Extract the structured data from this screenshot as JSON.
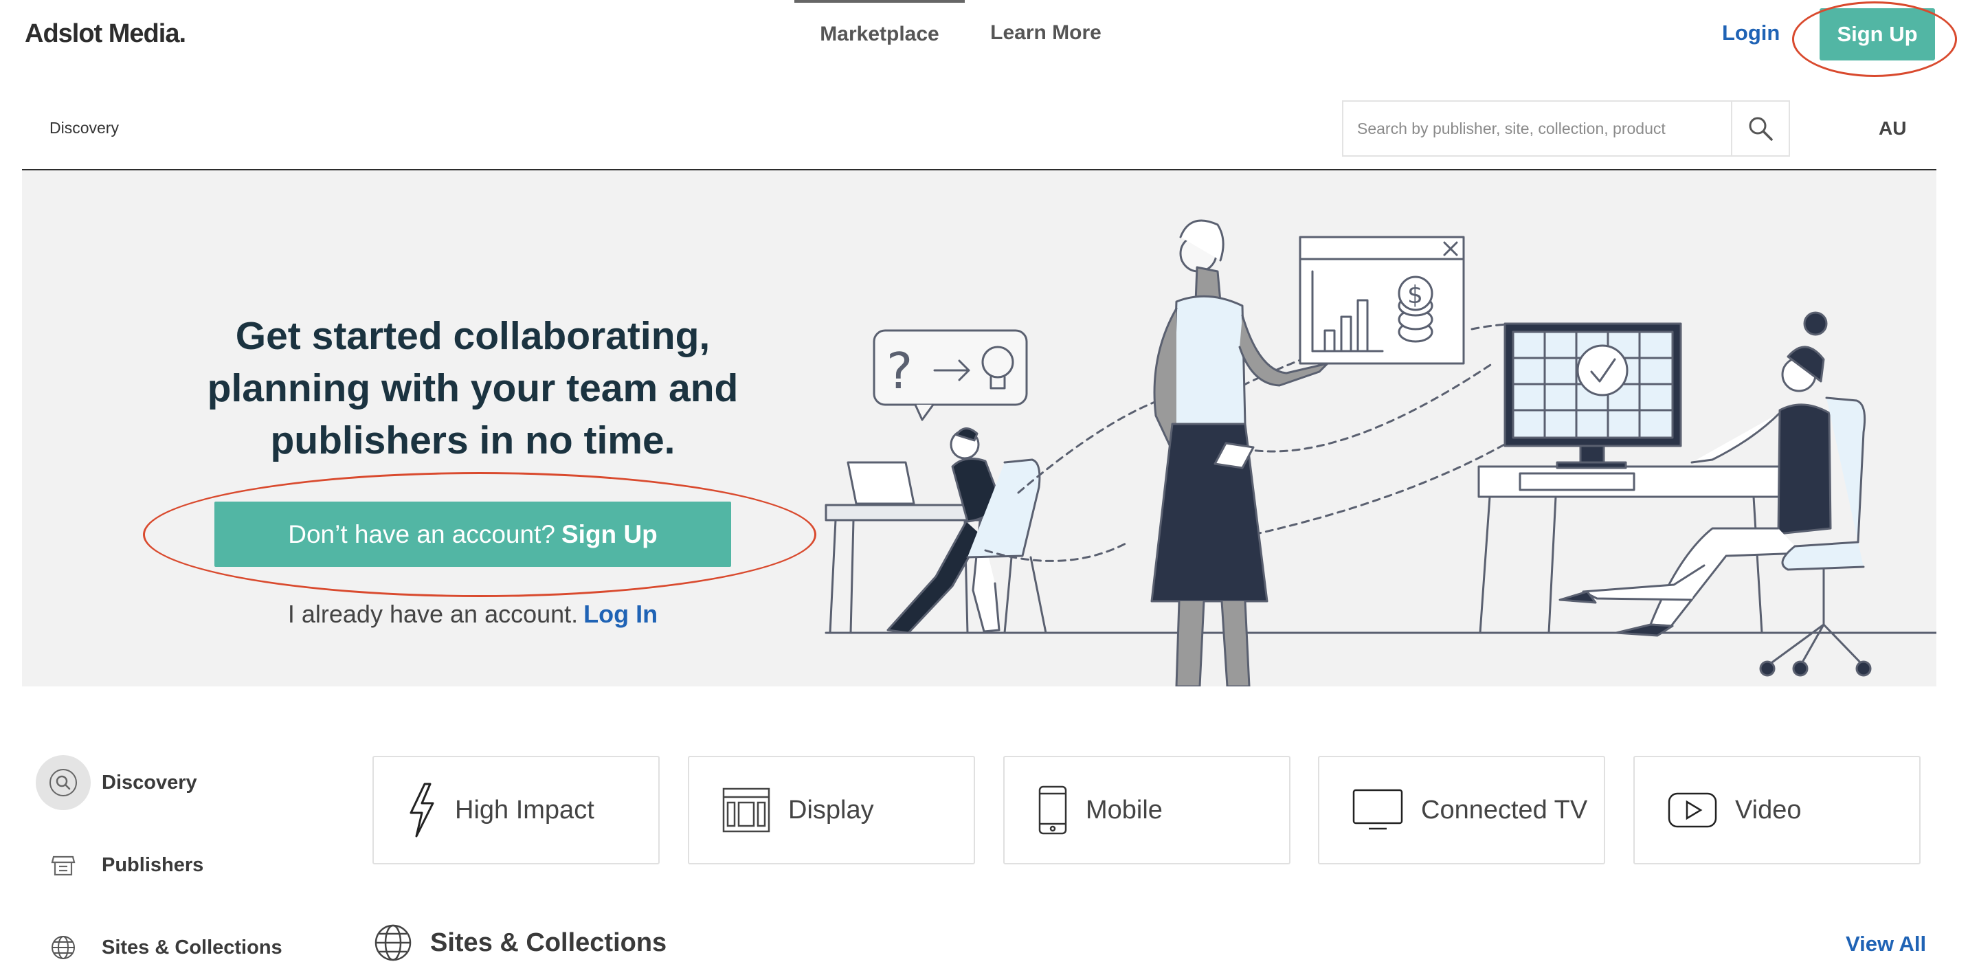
{
  "header": {
    "logo": "Adslot Media.",
    "tabs": [
      {
        "label": "Marketplace"
      },
      {
        "label": "Learn More"
      }
    ],
    "login_label": "Login",
    "signup_label": "Sign Up"
  },
  "subbar": {
    "breadcrumb": "Discovery",
    "search_placeholder": "Search by publisher, site, collection, product",
    "region": "AU"
  },
  "hero": {
    "title_lines": [
      "Get started collaborating,",
      "planning with your team and",
      "publishers in no time."
    ],
    "cta_prefix": "Don’t have an account?",
    "cta_strong": "Sign Up",
    "login_prefix": "I already have an account.",
    "login_link": "Log In"
  },
  "sidenav": {
    "items": [
      {
        "label": "Discovery",
        "icon": "discovery-icon"
      },
      {
        "label": "Publishers",
        "icon": "store-icon"
      },
      {
        "label": "Sites & Collections",
        "icon": "globe-icon"
      }
    ]
  },
  "categories": [
    {
      "label": "High Impact",
      "icon": "lightning-icon"
    },
    {
      "label": "Display",
      "icon": "display-layout-icon"
    },
    {
      "label": "Mobile",
      "icon": "mobile-phone-icon"
    },
    {
      "label": "Connected TV",
      "icon": "tv-icon"
    },
    {
      "label": "Video",
      "icon": "play-icon"
    }
  ],
  "sites_section": {
    "title": "Sites & Collections",
    "view_all": "View All"
  },
  "colors": {
    "accent": "#52b6a4",
    "link": "#1f63b5",
    "annotation": "#d94a2e"
  }
}
